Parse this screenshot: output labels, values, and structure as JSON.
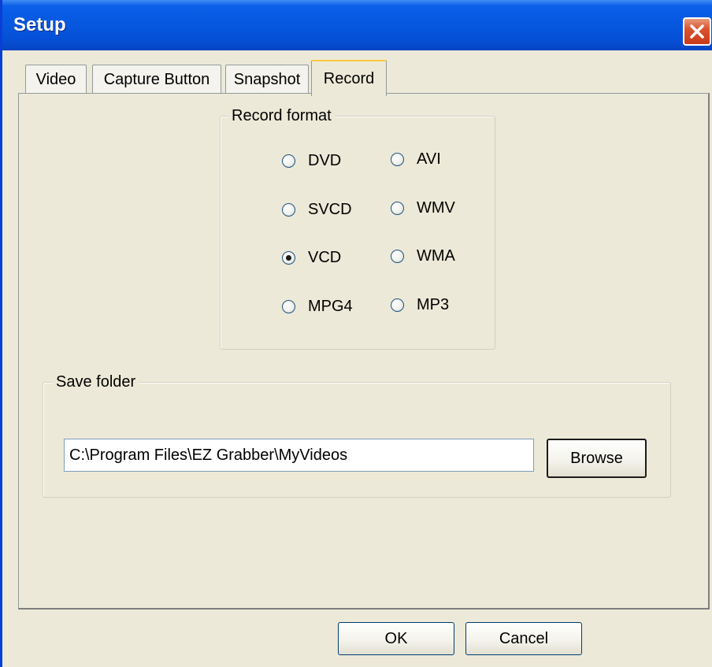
{
  "window": {
    "title": "Setup",
    "close_icon": "close-icon"
  },
  "tabs": [
    {
      "label": "Video",
      "selected": false
    },
    {
      "label": "Capture Button",
      "selected": false
    },
    {
      "label": "Snapshot",
      "selected": false
    },
    {
      "label": "Record",
      "selected": true
    }
  ],
  "record_format": {
    "label": "Record format",
    "selected": "VCD",
    "options": [
      "DVD",
      "AVI",
      "SVCD",
      "WMV",
      "VCD",
      "WMA",
      "MPG4",
      "MP3"
    ]
  },
  "save_folder": {
    "label": "Save folder",
    "path": "C:\\Program Files\\EZ Grabber\\MyVideos",
    "browse_label": "Browse"
  },
  "footer": {
    "ok_label": "OK",
    "cancel_label": "Cancel"
  },
  "colors": {
    "titlebar": "#0758E0",
    "dialog_bg": "#ECE9D8",
    "close_button": "#D9542F",
    "active_tab_accent": "#FFC73C"
  }
}
